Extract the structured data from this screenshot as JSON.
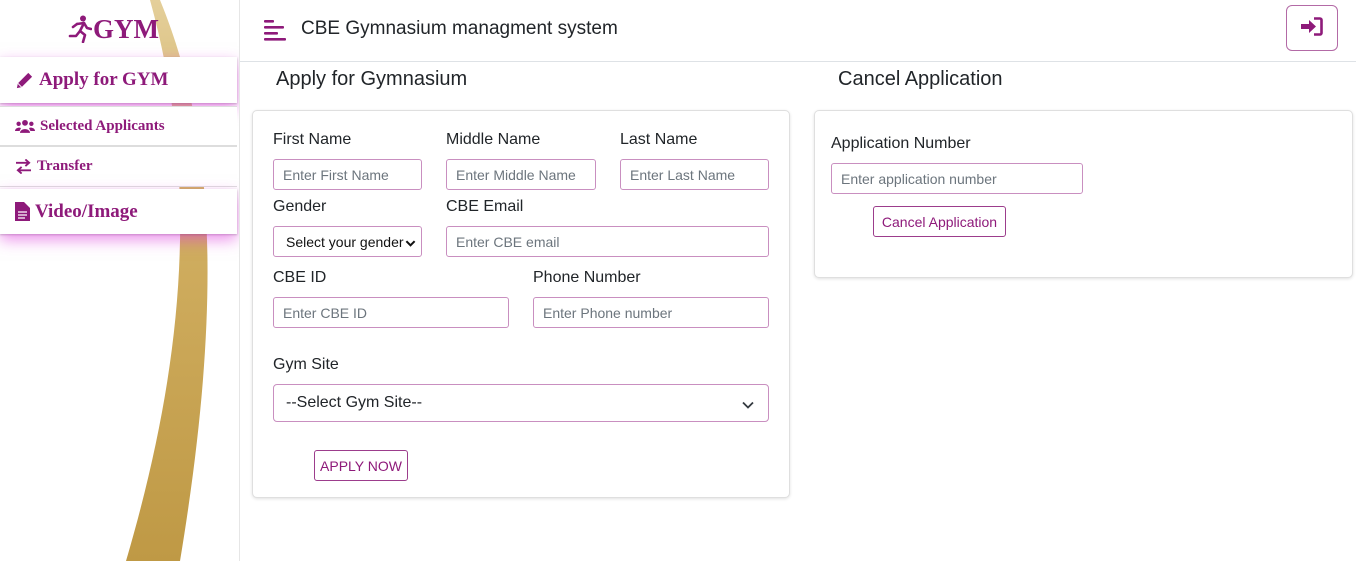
{
  "brand": {
    "logo_text": "GYM",
    "accent": "#8e1a7a",
    "swoosh_color": "#c9a453"
  },
  "sidebar": {
    "items": [
      {
        "label": "Apply for GYM",
        "icon": "pencil-icon"
      },
      {
        "label": "Selected Applicants",
        "icon": "users-icon"
      },
      {
        "label": "Transfer",
        "icon": "transfer-arrows-icon"
      },
      {
        "label": "Video/Image",
        "icon": "file-icon"
      }
    ]
  },
  "header": {
    "title": "CBE Gymnasium managment system",
    "menu_icon": "menu-lines-icon",
    "login_icon": "sign-in-icon"
  },
  "apply": {
    "title": "Apply for Gymnasium",
    "first_name": {
      "label": "First Name",
      "placeholder": "Enter First Name",
      "value": ""
    },
    "middle_name": {
      "label": "Middle Name",
      "placeholder": "Enter Middle Name",
      "value": ""
    },
    "last_name": {
      "label": "Last Name",
      "placeholder": "Enter Last Name",
      "value": ""
    },
    "gender": {
      "label": "Gender",
      "selected": "Select your gender"
    },
    "email": {
      "label": "CBE Email",
      "placeholder": "Enter CBE email",
      "value": ""
    },
    "cbe_id": {
      "label": "CBE ID",
      "placeholder": "Enter CBE ID",
      "value": ""
    },
    "phone": {
      "label": "Phone Number",
      "placeholder": "Enter Phone number",
      "value": ""
    },
    "gym_site": {
      "label": "Gym Site",
      "selected": "--Select Gym Site--"
    },
    "submit_label": "APPLY NOW"
  },
  "cancel": {
    "title": "Cancel Application",
    "app_number": {
      "label": "Application Number",
      "placeholder": "Enter application number",
      "value": ""
    },
    "button_label": "Cancel Application"
  }
}
